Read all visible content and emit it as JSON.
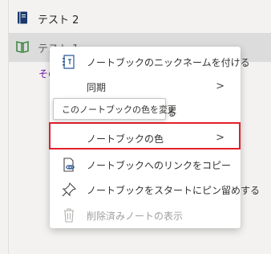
{
  "notebooks": [
    {
      "label": "テスト 2",
      "icon": "notebook-icon",
      "color": "#1a3a6c"
    },
    {
      "label": "テスト 1",
      "icon": "notebook-open-icon",
      "color": "#2e7d32"
    }
  ],
  "other_link": "その",
  "menu": {
    "items": [
      {
        "label": "ノートブックのニックネームを付ける",
        "icon": "rename-icon"
      },
      {
        "label": "同期",
        "has_submenu": true
      },
      {
        "label": "ノートブックを閉じる",
        "visible_fragment": "る"
      },
      {
        "label": "ノートブックの色",
        "has_submenu": true
      },
      {
        "label": "ノートブックへのリンクをコピー",
        "icon": "copy-link-icon"
      },
      {
        "label": "ノートブックをスタートにピン留めする",
        "icon": "pin-icon"
      },
      {
        "label": "削除済みノートの表示",
        "icon": "trash-icon",
        "disabled": true
      }
    ],
    "chevron": ">"
  },
  "tooltip": "このノートブックの色を変更",
  "highlight_color": "#e3202a"
}
